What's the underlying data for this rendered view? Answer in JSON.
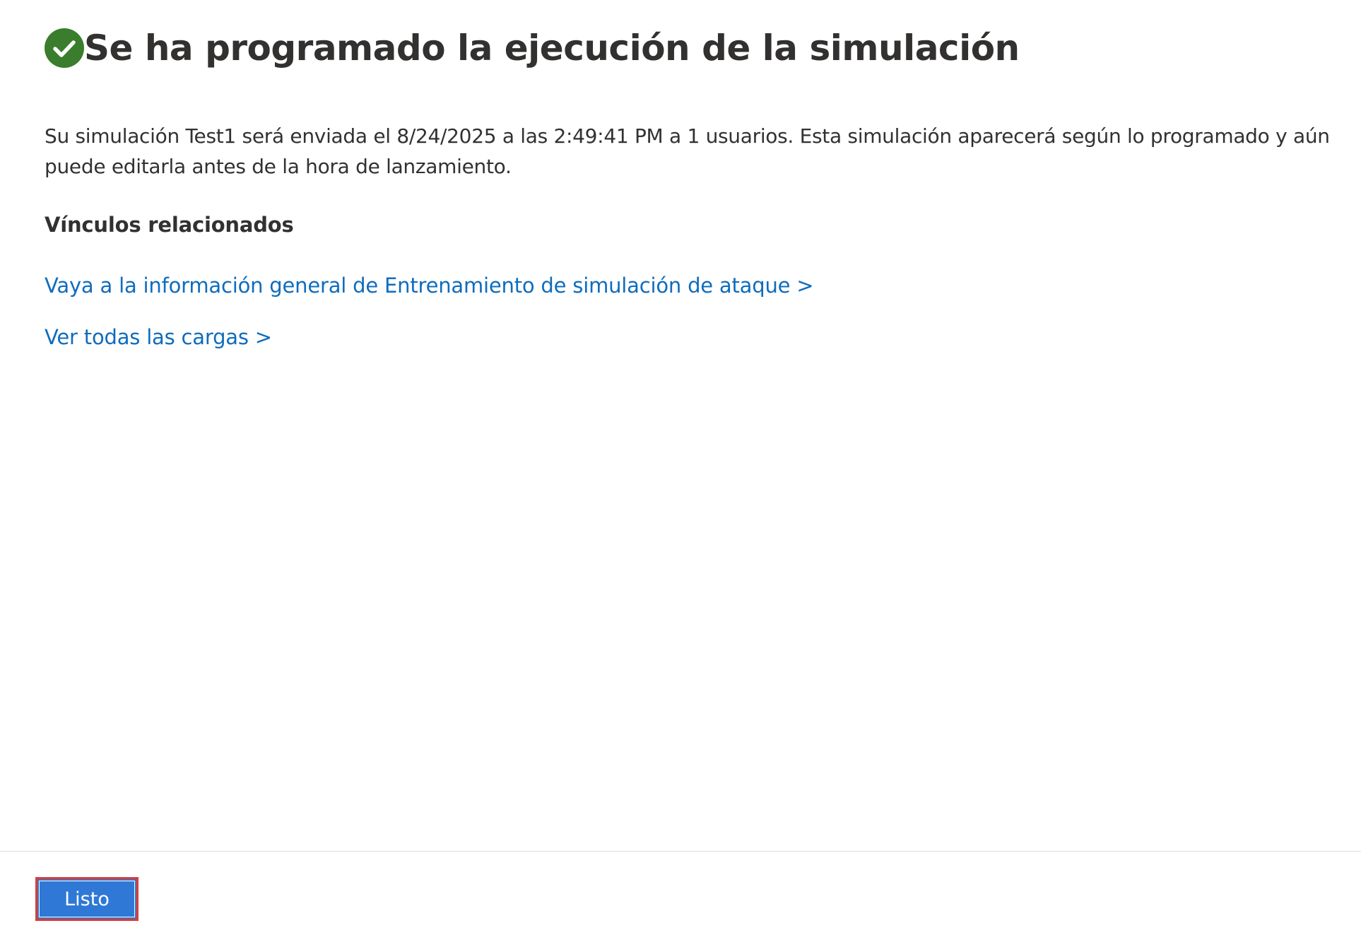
{
  "header": {
    "title": "Se ha programado la ejecución de la simulación",
    "status_icon": "success-check-icon",
    "status_color": "#3a7d2c"
  },
  "main": {
    "description": "Su simulación Test1 será enviada el 8/24/2025 a las 2:49:41 PM a 1 usuarios. Esta simulación aparecerá según lo programado y aún puede editarla antes de la hora de lanzamiento.",
    "related_links_heading": "Vínculos relacionados",
    "links": [
      {
        "label": "Vaya a la información general de Entrenamiento de simulación de ataque >"
      },
      {
        "label": "Ver todas las cargas >"
      }
    ]
  },
  "footer": {
    "done_label": "Listo"
  },
  "colors": {
    "link": "#0f6cbd",
    "primary_button": "#2f78d6",
    "highlight_border": "#e03a2f"
  }
}
